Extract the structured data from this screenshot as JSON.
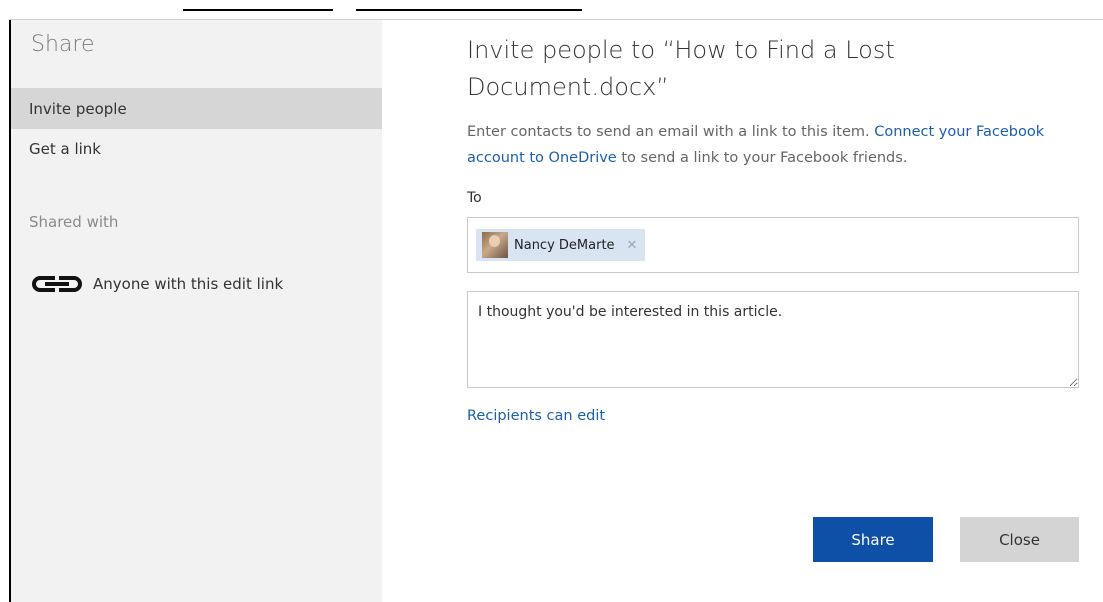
{
  "sidebar": {
    "title": "Share",
    "nav": [
      {
        "label": "Invite people",
        "active": true
      },
      {
        "label": "Get a link",
        "active": false
      }
    ],
    "shared_heading": "Shared with",
    "shared_entry": {
      "icon": "link-icon",
      "label": "Anyone with this edit link"
    }
  },
  "main": {
    "title": "Invite people to “How to Find a Lost Document.docx”",
    "description_prefix": "Enter contacts to send an email with a link to this item. ",
    "description_link": "Connect your Facebook account to OneDrive",
    "description_suffix": " to send a link to your Facebook friends.",
    "to_label": "To",
    "recipients": [
      {
        "name": "Nancy DeMarte",
        "avatar": "person-photo",
        "remove_icon": "close-icon"
      }
    ],
    "message": "I thought you'd be interested in this article.",
    "permission_link": "Recipients can edit",
    "share_button": "Share",
    "close_button": "Close"
  },
  "colors": {
    "accent": "#0e4fa8",
    "link": "#1c5fae",
    "sidebar_bg": "#f2f2f2",
    "sidebar_active": "#d6d6d6",
    "chip_bg": "#d9e4f3"
  }
}
